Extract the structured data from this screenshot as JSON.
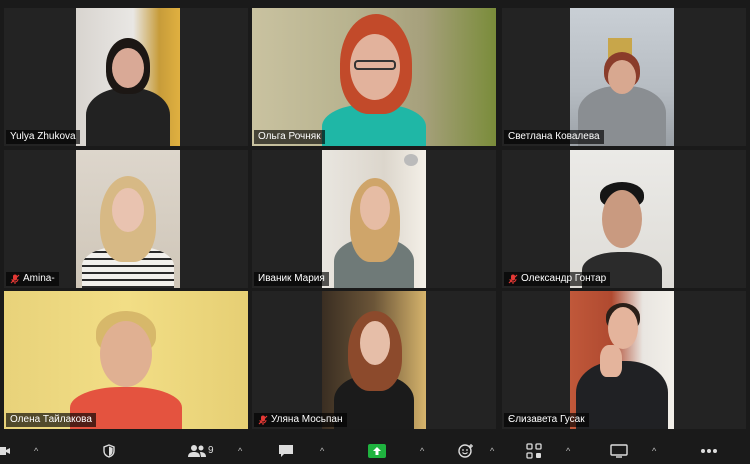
{
  "participants": [
    {
      "name": "Yulya Zhukova",
      "muted": false
    },
    {
      "name": "Ольга Рочняк",
      "muted": false,
      "active_speaker": true
    },
    {
      "name": "Светлана Ковалева",
      "muted": false
    },
    {
      "name": "Amina-",
      "muted": true
    },
    {
      "name": "Иваник Мария",
      "muted": false
    },
    {
      "name": "Олександр Гонтар",
      "muted": true
    },
    {
      "name": "Олена Тайлакова",
      "muted": false
    },
    {
      "name": "Уляна Мосьпан",
      "muted": true
    },
    {
      "name": "Єлизавета Гусак",
      "muted": false
    }
  ],
  "toolbar": {
    "participants_count": "9",
    "caret": "^",
    "icons": [
      "video-icon",
      "security-icon",
      "participants-icon",
      "chat-icon",
      "share-screen-icon",
      "reactions-icon",
      "apps-icon",
      "whiteboard-icon",
      "more-icon"
    ]
  },
  "colors": {
    "active_border": "#d6e04a",
    "share_green": "#1fb33f",
    "mute_red": "#e53935"
  }
}
